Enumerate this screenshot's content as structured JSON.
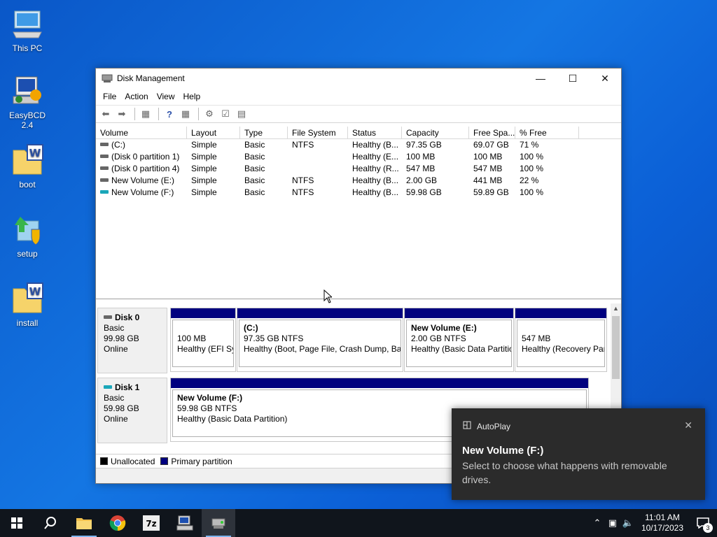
{
  "desktop": {
    "icons": [
      {
        "label": "This PC"
      },
      {
        "label": "EasyBCD 2.4"
      },
      {
        "label": "boot"
      },
      {
        "label": "setup"
      },
      {
        "label": "install"
      }
    ]
  },
  "window": {
    "title": "Disk Management",
    "menu": [
      "File",
      "Action",
      "View",
      "Help"
    ],
    "columns": [
      "Volume",
      "Layout",
      "Type",
      "File System",
      "Status",
      "Capacity",
      "Free Spa...",
      "% Free"
    ],
    "rows": [
      {
        "volume": "(C:)",
        "layout": "Simple",
        "type": "Basic",
        "fs": "NTFS",
        "status": "Healthy (B...",
        "capacity": "97.35 GB",
        "free": "69.07 GB",
        "pct": "71 %"
      },
      {
        "volume": "(Disk 0 partition 1)",
        "layout": "Simple",
        "type": "Basic",
        "fs": "",
        "status": "Healthy (E...",
        "capacity": "100 MB",
        "free": "100 MB",
        "pct": "100 %"
      },
      {
        "volume": "(Disk 0 partition 4)",
        "layout": "Simple",
        "type": "Basic",
        "fs": "",
        "status": "Healthy (R...",
        "capacity": "547 MB",
        "free": "547 MB",
        "pct": "100 %"
      },
      {
        "volume": "New Volume (E:)",
        "layout": "Simple",
        "type": "Basic",
        "fs": "NTFS",
        "status": "Healthy (B...",
        "capacity": "2.00 GB",
        "free": "441 MB",
        "pct": "22 %"
      },
      {
        "volume": "New Volume (F:)",
        "layout": "Simple",
        "type": "Basic",
        "fs": "NTFS",
        "status": "Healthy (B...",
        "capacity": "59.98 GB",
        "free": "59.89 GB",
        "pct": "100 %"
      }
    ],
    "disks": [
      {
        "name": "Disk 0",
        "type": "Basic",
        "size": "99.98 GB",
        "state": "Online",
        "partitions": [
          {
            "name": "",
            "size": "100 MB",
            "status": "Healthy (EFI Sy"
          },
          {
            "name": "(C:)",
            "size": "97.35 GB NTFS",
            "status": "Healthy (Boot, Page File, Crash Dump, Bas"
          },
          {
            "name": "New Volume  (E:)",
            "size": "2.00 GB NTFS",
            "status": "Healthy (Basic Data Partitio"
          },
          {
            "name": "",
            "size": "547 MB",
            "status": "Healthy (Recovery Par"
          }
        ]
      },
      {
        "name": "Disk 1",
        "type": "Basic",
        "size": "59.98 GB",
        "state": "Online",
        "partitions": [
          {
            "name": "New Volume  (F:)",
            "size": "59.98 GB NTFS",
            "status": "Healthy (Basic Data Partition)"
          }
        ]
      }
    ],
    "legend": [
      {
        "label": "Unallocated",
        "color": "#000000"
      },
      {
        "label": "Primary partition",
        "color": "#00007f"
      }
    ]
  },
  "toast": {
    "app": "AutoPlay",
    "title": "New Volume (F:)",
    "message": "Select to choose what happens with removable drives."
  },
  "taskbar": {
    "time": "11:01 AM",
    "date": "10/17/2023",
    "notification_count": "3"
  },
  "colors": {
    "primary_partition": "#00007f",
    "taskbar": "#10151c",
    "toast_bg": "#2b2b2b"
  }
}
